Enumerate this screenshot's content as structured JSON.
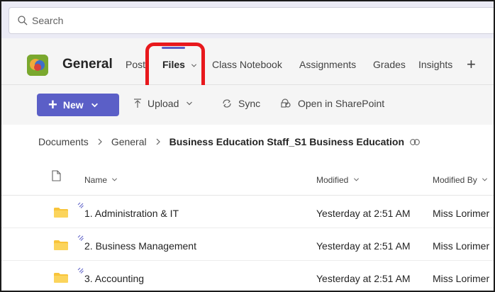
{
  "search": {
    "placeholder": "Search"
  },
  "header": {
    "channel_name": "General",
    "tabs": [
      {
        "label": "Post"
      },
      {
        "label": "Files"
      },
      {
        "label": "Class Notebook"
      },
      {
        "label": "Assignments"
      },
      {
        "label": "Grades"
      },
      {
        "label": "Insights"
      }
    ],
    "add_tab": "+",
    "selected_tab": "Files",
    "highlight_color": "#e8181c",
    "accent_color": "#5b5fc7"
  },
  "toolbar": {
    "new_label": "New",
    "upload_label": "Upload",
    "sync_label": "Sync",
    "sharepoint_label": "Open in SharePoint"
  },
  "breadcrumb": {
    "items": [
      "Documents",
      "General",
      "Business Education Staff_S1 Business Education"
    ]
  },
  "table": {
    "columns": {
      "name": "Name",
      "modified": "Modified",
      "modified_by": "Modified By"
    },
    "rows": [
      {
        "name": "1. Administration & IT",
        "modified": "Yesterday at 2:51 AM",
        "modified_by": "Miss Lorimer"
      },
      {
        "name": "2. Business Management",
        "modified": "Yesterday at 2:51 AM",
        "modified_by": "Miss Lorimer"
      },
      {
        "name": "3. Accounting",
        "modified": "Yesterday at 2:51 AM",
        "modified_by": "Miss Lorimer"
      }
    ]
  },
  "icons": {
    "search": "search-icon",
    "team_logo": "team-logo-icon",
    "upload": "upload-icon",
    "sync": "sync-icon",
    "sharepoint": "sharepoint-icon",
    "link": "link-icon",
    "document": "document-icon",
    "folder": "folder-icon",
    "new_item": "new-item-sparkle-icon"
  },
  "colors": {
    "folder": "#f8c43a"
  }
}
